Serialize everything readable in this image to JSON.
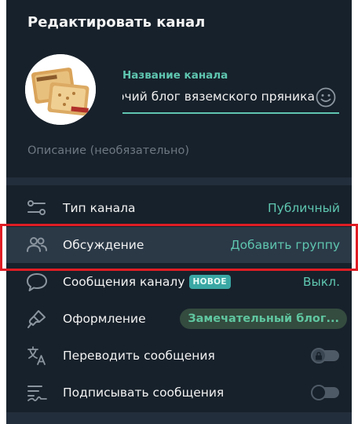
{
  "header": {
    "title": "Редактировать канал"
  },
  "channel": {
    "name_label": "Название канала",
    "name_value": "Рабочий блог вяземского пряника",
    "description_placeholder": "Описание (необязательно)"
  },
  "settings": {
    "type_label": "Тип канала",
    "type_value": "Публичный",
    "discussion_label": "Обсуждение",
    "discussion_value": "Добавить группу",
    "messages_label": "Сообщения каналу",
    "messages_badge": "НОВОЕ",
    "messages_value": "Выкл.",
    "appearance_label": "Оформление",
    "appearance_value": "Замечательный блог...",
    "translate_label": "Переводить сообщения",
    "sign_label": "Подписывать сообщения"
  },
  "colors": {
    "background": "#17212b",
    "accent": "#5fc6b0",
    "highlight_outline": "#e01d24"
  },
  "toggles": {
    "translate_enabled": false,
    "translate_locked": true,
    "sign_enabled": false
  }
}
